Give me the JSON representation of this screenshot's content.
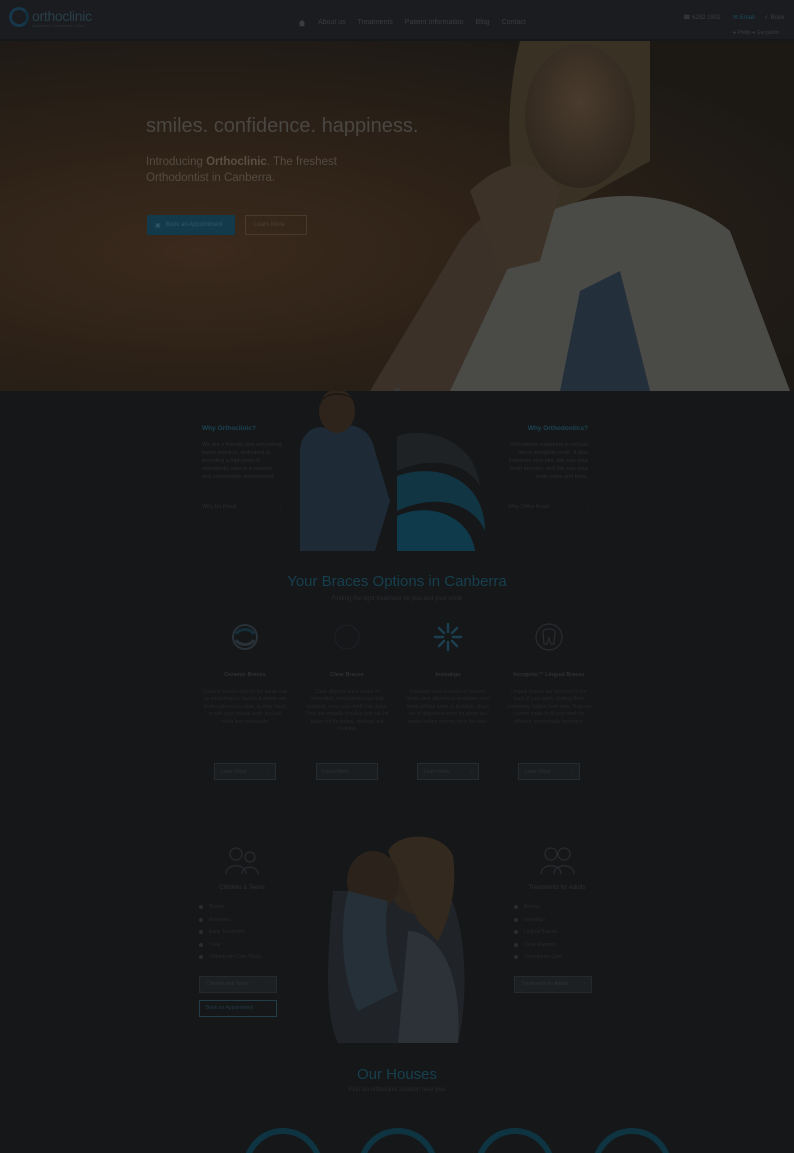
{
  "header": {
    "logo_text": "orthoclinic",
    "logo_tagline": "Canberra's Orthodontic Clinic",
    "nav": [
      "About us",
      "Treatments",
      "Patient Information",
      "Blog",
      "Contact"
    ],
    "phone": "6282 1902",
    "email": "Email",
    "book": "Book",
    "location_1": "Phillip",
    "location_2": "Gungahlin"
  },
  "hero": {
    "title": "smiles. confidence. happiness.",
    "intro": "Introducing",
    "brand": "Orthoclinic",
    "intro_rest": ". The freshest Orthodontist in Canberra.",
    "primary_button": "Book an Appointment",
    "secondary_button": "Learn More"
  },
  "why_left": {
    "heading": "Why Orthoclinic?",
    "text": "We are a friendly and welcoming family practice, dedicated to providing a high level of orthodontic care in a relaxed and comfortable environment.",
    "link": "Why Us  Read"
  },
  "why_right": {
    "heading": "Why Orthodontics?",
    "text": "Orthodontic treatment is not just about straighter teeth. It also improves your bite, the way your teeth function, and the way your smile looks and feels.",
    "link": "Why Ortho  Read"
  },
  "braces": {
    "title": "Your Braces Options in Canberra",
    "subtitle": "Finding the right treatment for you and your smile",
    "cards": [
      {
        "name": "Ceramic Braces",
        "text": "Ceramic braces work in the same way as metal braces, but the brackets are tooth-coloured or clear, so they blend in with your natural teeth and are much less noticeable.",
        "button": "Learn More",
        "icon": "ceramic-braces-icon"
      },
      {
        "name": "Clear Braces",
        "text": "Clear aligners are a series of removable, transparent trays that gradually move your teeth into place. They are virtually invisible and can be taken out for eating, drinking and cleaning.",
        "button": "Learn More",
        "icon": "clear-braces-icon"
      },
      {
        "name": "Invisalign",
        "text": "Invisalign uses a series of custom-made clear aligners to straighten your teeth without wires or brackets. Each set of aligners is worn for about two weeks before moving on to the next.",
        "button": "Learn More",
        "icon": "invisalign-icon"
      },
      {
        "name": "Incognito™ Lingual Braces",
        "text": "Lingual braces are attached to the back of your teeth, making them completely hidden from view. They are custom made to fit your teeth for efficient, comfortable treatment.",
        "button": "Learn More",
        "icon": "lingual-braces-icon"
      }
    ]
  },
  "families": {
    "left": {
      "title": "Children & Teens",
      "items": [
        "Braces",
        "Retainers",
        "Early Treatment",
        "Clear",
        "Orthodontic Care Plans"
      ],
      "button": "Children and Teens",
      "button2": "Book an Appointment"
    },
    "right": {
      "title": "Treatments for Adults",
      "items": [
        "Braces",
        "Invisalign",
        "Lingual Braces",
        "Clear Aligners",
        "Orthodontic Care"
      ],
      "button": "Treatments for Adults"
    }
  },
  "houses": {
    "title": "Our Houses",
    "subtitle": "Find an orthoclinic location near you"
  }
}
